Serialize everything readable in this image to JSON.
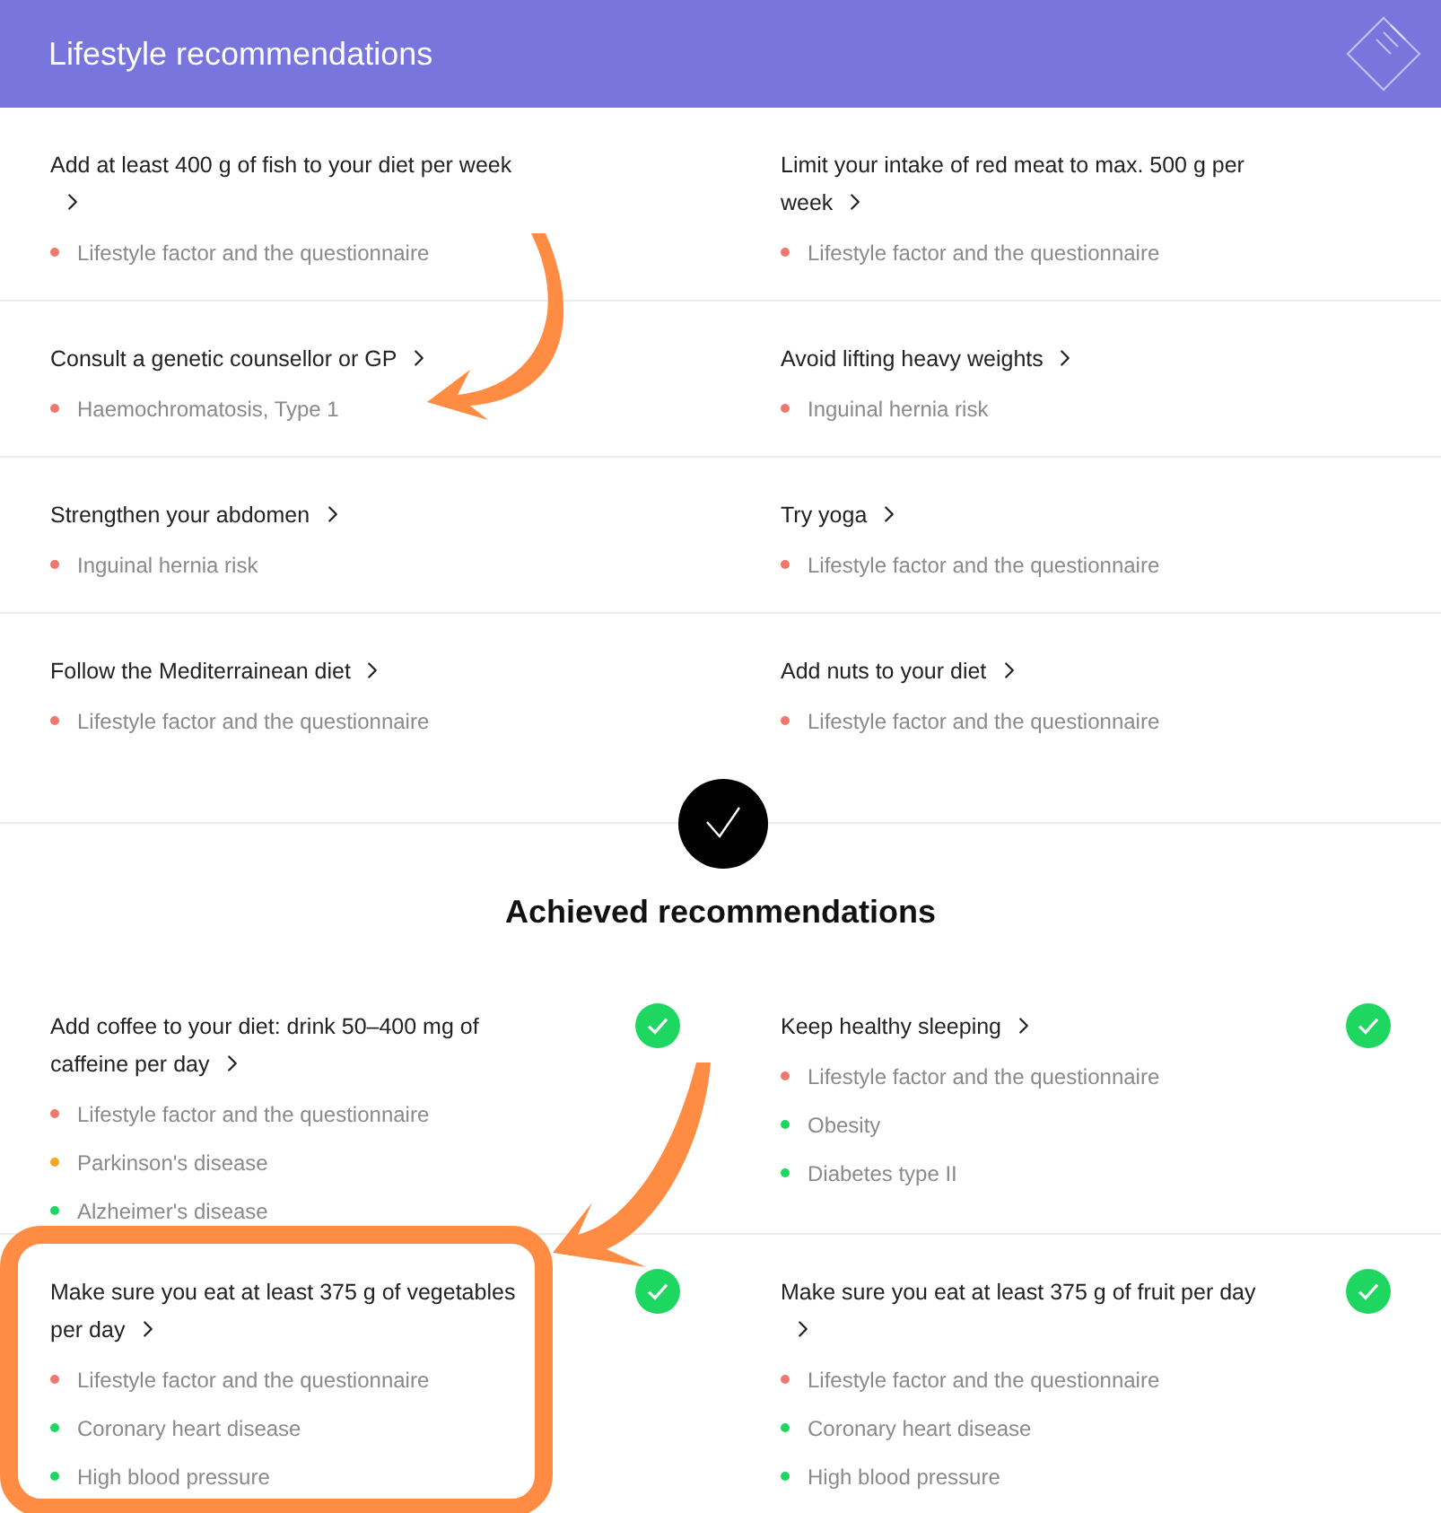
{
  "header": {
    "title": "Lifestyle recommendations"
  },
  "pending": [
    {
      "title": "Add at least 400 g of fish to your diet per week",
      "reasons": [
        {
          "text": "Lifestyle factor and the questionnaire",
          "color": "#f0776b"
        }
      ]
    },
    {
      "title": "Limit your intake of red meat to max. 500 g per week",
      "reasons": [
        {
          "text": "Lifestyle factor and the questionnaire",
          "color": "#f0776b"
        }
      ]
    },
    {
      "title": "Consult a genetic counsellor or GP",
      "reasons": [
        {
          "text": "Haemochromatosis, Type 1",
          "color": "#f0776b"
        }
      ]
    },
    {
      "title": "Avoid lifting heavy weights",
      "reasons": [
        {
          "text": "Inguinal hernia risk",
          "color": "#f0776b"
        }
      ]
    },
    {
      "title": "Strengthen your abdomen",
      "reasons": [
        {
          "text": "Inguinal hernia risk",
          "color": "#f0776b"
        }
      ]
    },
    {
      "title": "Try yoga",
      "reasons": [
        {
          "text": "Lifestyle factor and the questionnaire",
          "color": "#f0776b"
        }
      ]
    },
    {
      "title": "Follow the Mediterrainean diet",
      "reasons": [
        {
          "text": "Lifestyle factor and the questionnaire",
          "color": "#f0776b"
        }
      ]
    },
    {
      "title": "Add nuts to your diet",
      "reasons": [
        {
          "text": "Lifestyle factor and the questionnaire",
          "color": "#f0776b"
        }
      ]
    }
  ],
  "achieved_title": "Achieved recommendations",
  "achieved": [
    {
      "title": "Add coffee to your diet: drink 50–400 mg of caffeine per day",
      "achieved": true,
      "reasons": [
        {
          "text": "Lifestyle factor and the questionnaire",
          "color": "#f0776b"
        },
        {
          "text": "Parkinson's disease",
          "color": "#f5a623"
        },
        {
          "text": "Alzheimer's disease",
          "color": "#1ed760"
        }
      ]
    },
    {
      "title": "Keep healthy sleeping",
      "achieved": true,
      "reasons": [
        {
          "text": "Lifestyle factor and the questionnaire",
          "color": "#f0776b"
        },
        {
          "text": "Obesity",
          "color": "#1ed760"
        },
        {
          "text": "Diabetes type II",
          "color": "#1ed760"
        }
      ]
    },
    {
      "title": "Make sure you eat at least 375 g of vegetables per day",
      "achieved": true,
      "reasons": [
        {
          "text": "Lifestyle factor and the questionnaire",
          "color": "#f0776b"
        },
        {
          "text": "Coronary heart disease",
          "color": "#1ed760"
        },
        {
          "text": "High blood pressure",
          "color": "#1ed760"
        }
      ]
    },
    {
      "title": "Make sure you eat at least 375 g of fruit per day",
      "achieved": true,
      "reasons": [
        {
          "text": "Lifestyle factor and the questionnaire",
          "color": "#f0776b"
        },
        {
          "text": "Coronary heart disease",
          "color": "#1ed760"
        },
        {
          "text": "High blood pressure",
          "color": "#1ed760"
        }
      ]
    }
  ]
}
